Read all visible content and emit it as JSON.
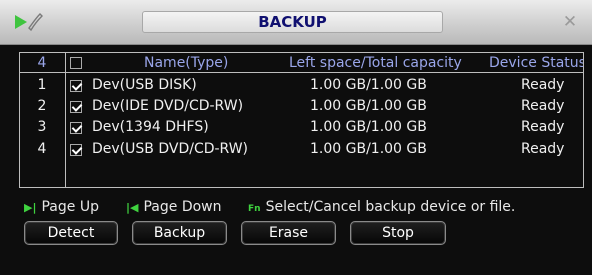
{
  "window": {
    "title": "BACKUP"
  },
  "table": {
    "count": "4",
    "headers": {
      "name": "Name(Type)",
      "space": "Left space/Total capacity",
      "status": "Device Status"
    },
    "rows": [
      {
        "index": "1",
        "checked": true,
        "name": "Dev(USB DISK)",
        "space": "1.00 GB/1.00 GB",
        "status": "Ready"
      },
      {
        "index": "2",
        "checked": true,
        "name": "Dev(IDE DVD/CD-RW)",
        "space": "1.00 GB/1.00 GB",
        "status": "Ready"
      },
      {
        "index": "3",
        "checked": true,
        "name": "Dev(1394 DHFS)",
        "space": "1.00 GB/1.00 GB",
        "status": "Ready"
      },
      {
        "index": "4",
        "checked": true,
        "name": "Dev(USB DVD/CD-RW)",
        "space": "1.00 GB/1.00 GB",
        "status": "Ready"
      }
    ]
  },
  "hints": {
    "page_up": "Page Up",
    "page_down": "Page Down",
    "fn_label": "Fn",
    "select": "Select/Cancel backup device or file."
  },
  "buttons": {
    "detect": "Detect",
    "backup": "Backup",
    "erase": "Erase",
    "stop": "Stop"
  },
  "colors": {
    "header_text": "#9aa6ea",
    "title_text": "#101070",
    "hint_icon": "#3fd23f"
  }
}
